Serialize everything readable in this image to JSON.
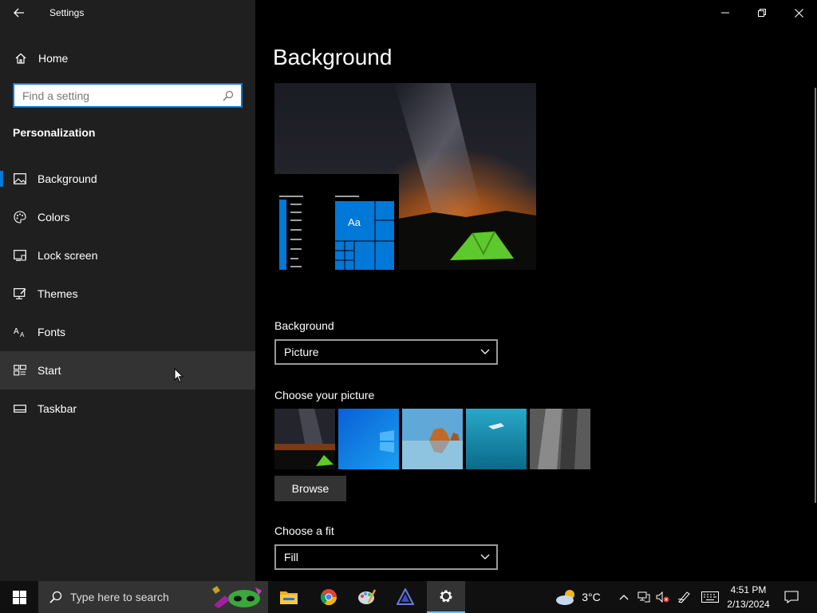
{
  "window": {
    "title": "Settings"
  },
  "sidebar": {
    "home_label": "Home",
    "search_placeholder": "Find a setting",
    "section_title": "Personalization",
    "items": [
      {
        "label": "Background",
        "icon": "picture-icon"
      },
      {
        "label": "Colors",
        "icon": "palette-icon"
      },
      {
        "label": "Lock screen",
        "icon": "lock-screen-icon"
      },
      {
        "label": "Themes",
        "icon": "themes-icon"
      },
      {
        "label": "Fonts",
        "icon": "fonts-icon"
      },
      {
        "label": "Start",
        "icon": "start-icon"
      },
      {
        "label": "Taskbar",
        "icon": "taskbar-icon"
      }
    ],
    "selected": "Background",
    "hovered": "Start"
  },
  "main": {
    "page_title": "Background",
    "preview_sample_text": "Aa",
    "background_label": "Background",
    "background_value": "Picture",
    "choose_picture_label": "Choose your picture",
    "thumbnails": [
      "milky-way-tent",
      "windows-blue",
      "beach-rocks",
      "underwater-swimmer",
      "rock-cliff"
    ],
    "browse_label": "Browse",
    "fit_label": "Choose a fit",
    "fit_value": "Fill"
  },
  "taskbar": {
    "search_placeholder": "Type here to search",
    "weather_temp": "3°C",
    "time": "4:51 PM",
    "date": "2/13/2024"
  },
  "colors": {
    "accent": "#0078d7",
    "sidebar_bg": "#1f1f1f",
    "main_bg": "#000000",
    "taskbar_bg": "#101010"
  }
}
